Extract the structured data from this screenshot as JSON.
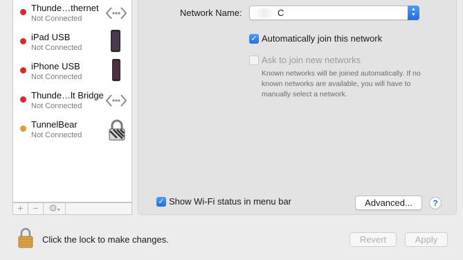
{
  "sidebar": {
    "services": [
      {
        "name": "Thunde…thernet",
        "status": "Not Connected",
        "status_color": "#e32529",
        "icon": "ethernet-arrows-icon"
      },
      {
        "name": "iPad USB",
        "status": "Not Connected",
        "status_color": "#e32529",
        "icon": "ipad-icon"
      },
      {
        "name": "iPhone USB",
        "status": "Not Connected",
        "status_color": "#e32529",
        "icon": "iphone-icon"
      },
      {
        "name": "Thunde…lt Bridge",
        "status": "Not Connected",
        "status_color": "#e32529",
        "icon": "bridge-arrows-icon"
      },
      {
        "name": "TunnelBear",
        "status": "Not Connected",
        "status_color": "#e0a030",
        "icon": "vpn-lock-icon"
      }
    ],
    "toolbar": {
      "add": "+",
      "remove": "−",
      "action": "⚙"
    }
  },
  "panel": {
    "network_name_label": "Network Name:",
    "network_name_value": "C",
    "auto_join_label": "Automatically join this network",
    "auto_join_checked": true,
    "ask_join_label": "Ask to join new networks",
    "ask_join_checked": false,
    "ask_join_note": "Known networks will be joined automatically. If no known networks are available, you will have to manually select a network.",
    "show_wifi_label": "Show Wi-Fi status in menu bar",
    "show_wifi_checked": true,
    "advanced_button": "Advanced...",
    "help_button": "?"
  },
  "footer": {
    "lock_text": "Click the lock to make changes.",
    "revert_button": "Revert",
    "apply_button": "Apply"
  },
  "colors": {
    "accent": "#1f70e2",
    "status_red": "#e32529",
    "status_orange": "#e0a030"
  }
}
